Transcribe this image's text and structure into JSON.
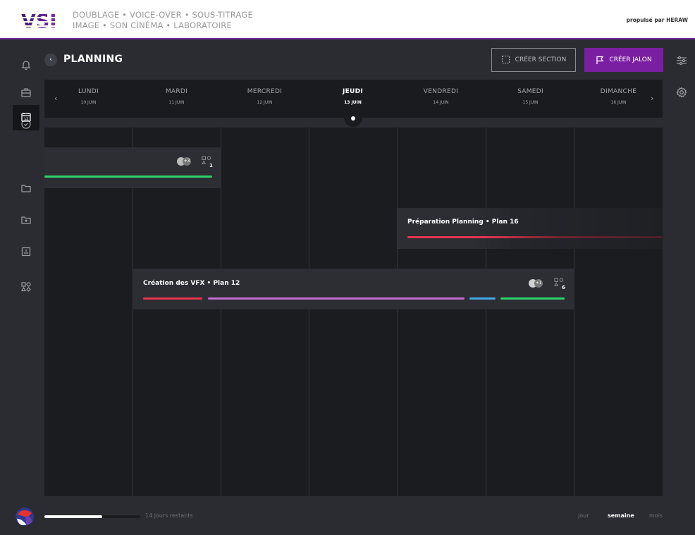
{
  "brand": {
    "logo_text": "VSI",
    "tagline_line1": "DOUBLAGE • VOICE-OVER • SOUS-TITRAGE",
    "tagline_line2": "IMAGE • SON CINÉMA • LABORATOIRE",
    "powered_by": "propulsé par HERAW"
  },
  "header": {
    "title": "PLANNING",
    "create_section_label": "CRÉER SECTION",
    "create_jalon_label": "CRÉER JALON"
  },
  "rail_icons": [
    "bell-icon",
    "briefcase-icon",
    "check-circle-icon",
    "calendar-icon",
    "folder-icon",
    "folder-upload-icon",
    "inbox-icon",
    "shapes-icon"
  ],
  "colors": {
    "accent": "#7b1fa2",
    "bar_red": "#e8344e",
    "bar_green": "#2fd06a",
    "bar_purple": "#c66ad6",
    "bar_blue": "#43a8e6"
  },
  "days": [
    {
      "name": "LUNDI",
      "date": "10 JUIN",
      "today": false
    },
    {
      "name": "MARDI",
      "date": "11 JUIN",
      "today": false
    },
    {
      "name": "MERCREDI",
      "date": "12 JUIN",
      "today": false
    },
    {
      "name": "JEUDI",
      "date": "13 JUIN",
      "today": true
    },
    {
      "name": "VENDREDI",
      "date": "14 JUIN",
      "today": false
    },
    {
      "name": "SAMEDI",
      "date": "15 JUIN",
      "today": false
    },
    {
      "name": "DIMANCHE",
      "date": "16 JUIN",
      "today": false
    }
  ],
  "tasks": [
    {
      "title": "",
      "avatar_extra": "+3",
      "shapes_count": "1"
    },
    {
      "title": "Préparation Planning • Plan 16"
    },
    {
      "title": "Création des VFX • Plan 12",
      "avatar_extra": "+1",
      "shapes_count": "6"
    }
  ],
  "footer": {
    "progress_percent": 60,
    "remaining_label": "14 jours restants",
    "views": [
      "jour",
      "semaine",
      "mois"
    ],
    "active_view": "semaine"
  }
}
